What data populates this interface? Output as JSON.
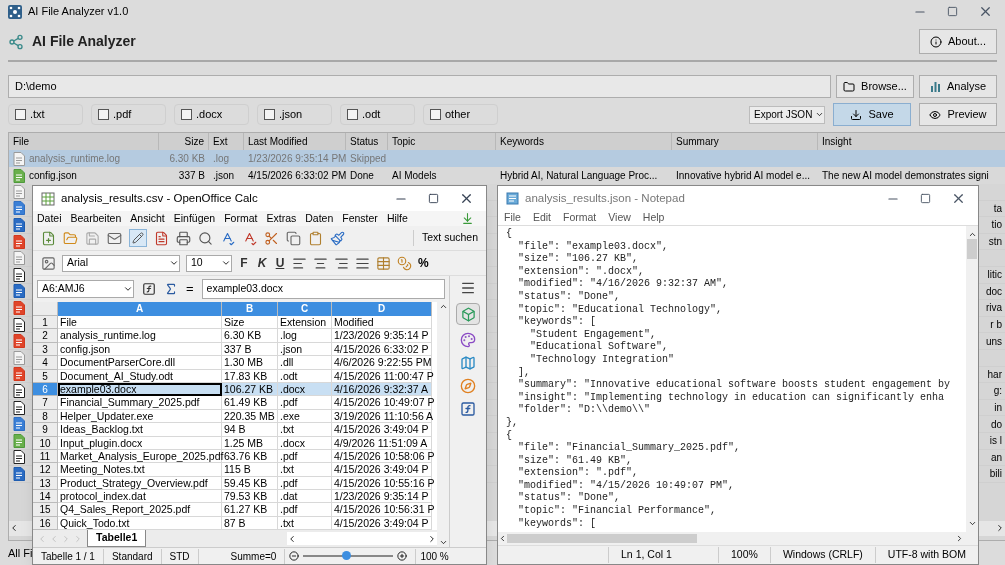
{
  "window": {
    "title": "AI File Analyzer v1.0"
  },
  "header": {
    "title": "AI File Analyzer",
    "about_button": "About..."
  },
  "path_field": {
    "value": "D:\\demo"
  },
  "browse_button": "Browse...",
  "analyse_button": "Analyse",
  "filters": [
    {
      "label": ".txt",
      "checked": false
    },
    {
      "label": ".pdf",
      "checked": false
    },
    {
      "label": ".docx",
      "checked": false
    },
    {
      "label": ".json",
      "checked": false
    },
    {
      "label": ".odt",
      "checked": false
    },
    {
      "label": "other",
      "checked": false
    }
  ],
  "export_select": {
    "value": "Export JSON"
  },
  "save_button": {
    "label": "Save",
    "focused": true
  },
  "preview_button": "Preview",
  "table": {
    "columns": [
      "File",
      "Size",
      "Ext",
      "Last Modified",
      "Status",
      "Topic",
      "Keywords",
      "Summary",
      "Insight"
    ],
    "rows": [
      {
        "kind": "file",
        "selected": true,
        "disabled": true,
        "cells": [
          "analysis_runtime.log",
          "6.30 KB",
          ".log",
          "1/23/2026 9:35:14 PM",
          "Skipped",
          "",
          "",
          "",
          ""
        ]
      },
      {
        "kind": "green",
        "selected": false,
        "disabled": false,
        "cells": [
          "config.json",
          "337 B",
          ".json",
          "4/15/2026 6:33:02 PM",
          "Done",
          "AI Models",
          "Hybrid AI, Natural Language Proc...",
          "Innovative hybrid AI model e...",
          "The new AI model demonstrates signi"
        ]
      }
    ],
    "covered_rows": [
      {
        "kind": "file"
      },
      {
        "kind": "doc",
        "insight": "ta"
      },
      {
        "kind": "word",
        "insight": "tio"
      },
      {
        "kind": "pdf",
        "insight": "stn"
      },
      {
        "kind": "file"
      },
      {
        "kind": "text",
        "insight": "litic"
      },
      {
        "kind": "word",
        "insight": "doc"
      },
      {
        "kind": "pdf",
        "insight": "riva"
      },
      {
        "kind": "text",
        "insight": "r b"
      },
      {
        "kind": "pdf",
        "insight": "uns"
      },
      {
        "kind": "file"
      },
      {
        "kind": "pdf",
        "insight": "har"
      },
      {
        "kind": "text",
        "insight": "g:"
      },
      {
        "kind": "text",
        "insight": "in"
      },
      {
        "kind": "doc",
        "insight": "do"
      },
      {
        "kind": "green",
        "insight": "is l"
      },
      {
        "kind": "text",
        "insight": "an"
      },
      {
        "kind": "word",
        "insight": "bili"
      }
    ]
  },
  "status_bar": "All Fi",
  "calc": {
    "title": "analysis_results.csv - OpenOffice Calc",
    "menu": [
      "Datei",
      "Bearbeiten",
      "Ansicht",
      "Einfügen",
      "Format",
      "Extras",
      "Daten",
      "Fenster",
      "Hilfe"
    ],
    "find_label": "Text suchen",
    "font": "Arial",
    "font_size": "10",
    "format_buttons": [
      {
        "label": "F",
        "kind": "bold"
      },
      {
        "label": "K",
        "kind": "italic"
      },
      {
        "label": "U",
        "kind": "underline"
      }
    ],
    "percent": "%",
    "name_box": "A6:AMJ6",
    "equals": "=",
    "formula": "example03.docx",
    "columns": [
      {
        "label": "A",
        "highlighted": true
      },
      {
        "label": "B",
        "highlighted": true
      },
      {
        "label": "C",
        "highlighted": true
      },
      {
        "label": "D",
        "highlighted": true
      }
    ],
    "rows": [
      {
        "number": "1",
        "selected": false,
        "cells": [
          "File",
          "Size",
          "Extension",
          "Modified"
        ]
      },
      {
        "number": "2",
        "selected": false,
        "cells": [
          "analysis_runtime.log",
          "6.30 KB",
          ".log",
          "1/23/2026 9:35:14 P"
        ]
      },
      {
        "number": "3",
        "selected": false,
        "cells": [
          "config.json",
          "337 B",
          ".json",
          "4/15/2026 6:33:02 P"
        ]
      },
      {
        "number": "4",
        "selected": false,
        "cells": [
          "DocumentParserCore.dll",
          "1.30 MB",
          ".dll",
          "4/6/2026 9:22:55 PM"
        ]
      },
      {
        "number": "5",
        "selected": false,
        "cells": [
          "Document_AI_Study.odt",
          "17.83 KB",
          ".odt",
          "4/15/2026 11:00:47 P"
        ]
      },
      {
        "number": "6",
        "selected": true,
        "cells": [
          "example03.docx",
          "106.27 KB",
          ".docx",
          "4/16/2026 9:32:37 A"
        ]
      },
      {
        "number": "7",
        "selected": false,
        "cells": [
          "Financial_Summary_2025.pdf",
          "61.49 KB",
          ".pdf",
          "4/15/2026 10:49:07 P"
        ]
      },
      {
        "number": "8",
        "selected": false,
        "cells": [
          "Helper_Updater.exe",
          "220.35 MB",
          ".exe",
          "3/19/2026 11:10:56 A"
        ]
      },
      {
        "number": "9",
        "selected": false,
        "cells": [
          "Ideas_Backlog.txt",
          "94 B",
          ".txt",
          "4/15/2026 3:49:04 P"
        ]
      },
      {
        "number": "10",
        "selected": false,
        "cells": [
          "Input_plugin.docx",
          "1.25 MB",
          ".docx",
          "4/9/2026 11:51:09 A"
        ]
      },
      {
        "number": "11",
        "selected": false,
        "cells": [
          "Market_Analysis_Europe_2025.pdf",
          "63.76 KB",
          ".pdf",
          "4/15/2026 10:58:06 P"
        ]
      },
      {
        "number": "12",
        "selected": false,
        "cells": [
          "Meeting_Notes.txt",
          "115 B",
          ".txt",
          "4/15/2026 3:49:04 P"
        ]
      },
      {
        "number": "13",
        "selected": false,
        "cells": [
          "Product_Strategy_Overview.pdf",
          "59.45 KB",
          ".pdf",
          "4/15/2026 10:55:16 P"
        ]
      },
      {
        "number": "14",
        "selected": false,
        "cells": [
          "protocol_index.dat",
          "79.53 KB",
          ".dat",
          "1/23/2026 9:35:14 P"
        ]
      },
      {
        "number": "15",
        "selected": false,
        "cells": [
          "Q4_Sales_Report_2025.pdf",
          "61.27 KB",
          ".pdf",
          "4/15/2026 10:56:31 P"
        ]
      },
      {
        "number": "16",
        "selected": false,
        "cells": [
          "Quick_Todo.txt",
          "87 B",
          ".txt",
          "4/15/2026 3:49:04 P"
        ]
      }
    ],
    "sheet_tab": "Tabelle1",
    "status": [
      "Tabelle 1 / 1",
      "Standard",
      "STD",
      "Summe=0"
    ],
    "zoom_slider": {
      "level": 0.47
    },
    "zoom_label": "100 %"
  },
  "notepad": {
    "title": "analysis_results.json - Notepad",
    "menu": [
      "File",
      "Edit",
      "Format",
      "View",
      "Help"
    ],
    "lines": [
      "{",
      "  \"file\": \"example03.docx\",",
      "  \"size\": \"106.27 KB\",",
      "  \"extension\": \".docx\",",
      "  \"modified\": \"4/16/2026 9:32:37 AM\",",
      "  \"status\": \"Done\",",
      "  \"topic\": \"Educational Technology\",",
      "  \"keywords\": [",
      "    \"Student Engagement\",",
      "    \"Educational Software\",",
      "    \"Technology Integration\"",
      "  ],",
      "  \"summary\": \"Innovative educational software boosts student engagement by",
      "  \"insight\": \"Implementing technology in education can significantly enha",
      "  \"folder\": \"D:\\\\demo\\\\\"",
      "},",
      "{",
      "  \"file\": \"Financial_Summary_2025.pdf\",",
      "  \"size\": \"61.49 KB\",",
      "  \"extension\": \".pdf\",",
      "  \"modified\": \"4/15/2026 10:49:07 PM\",",
      "  \"status\": \"Done\",",
      "  \"topic\": \"Financial Performance\",",
      "  \"keywords\": ["
    ],
    "status": [
      "Ln 1, Col 1",
      "100%",
      "Windows (CRLF)",
      "UTF-8 with BOM"
    ]
  }
}
